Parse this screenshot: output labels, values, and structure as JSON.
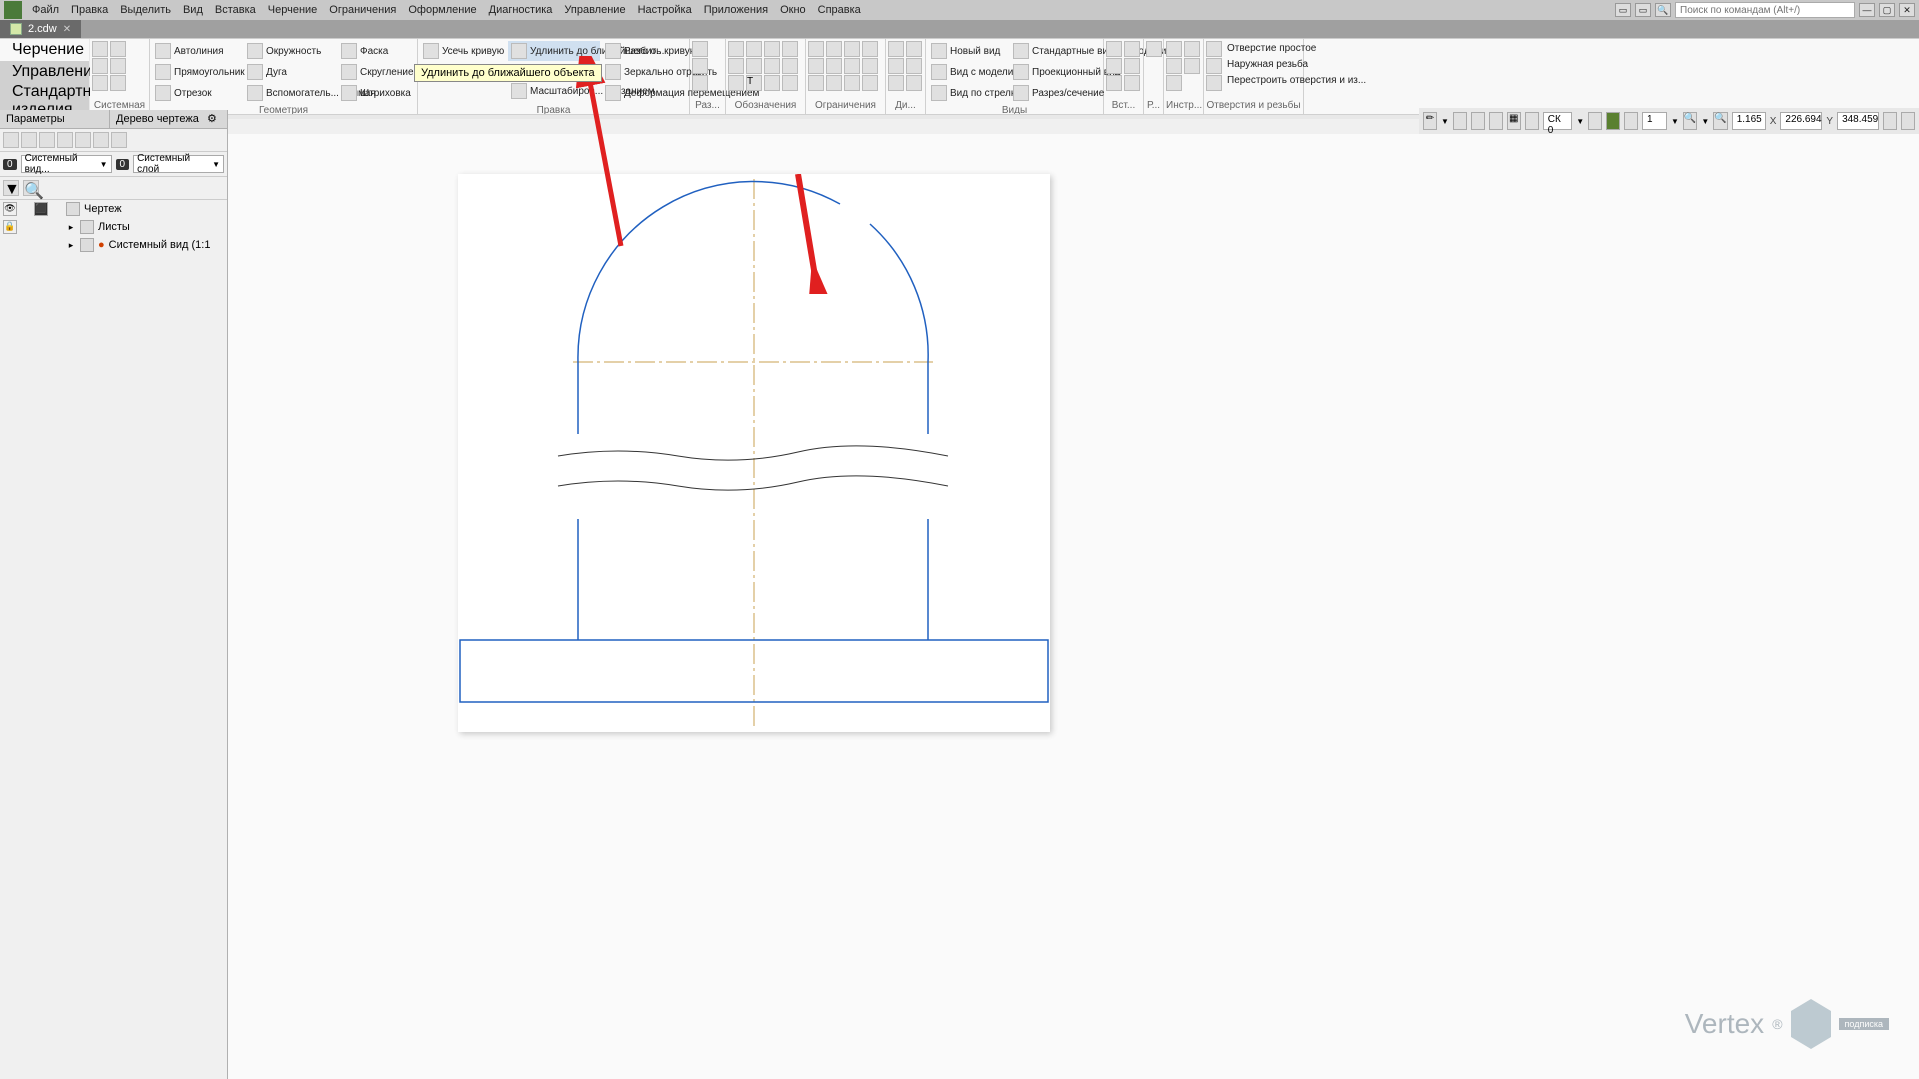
{
  "menu": [
    "Файл",
    "Правка",
    "Выделить",
    "Вид",
    "Вставка",
    "Черчение",
    "Ограничения",
    "Оформление",
    "Диагностика",
    "Управление",
    "Настройка",
    "Приложения",
    "Окно",
    "Справка"
  ],
  "search_placeholder": "Поиск по командам (Alt+/)",
  "doc_tab": "2.cdw",
  "ribbon_tabs": {
    "active": "Черчение",
    "other": "Управление",
    "third": "Стандартные изделия"
  },
  "tooltip": "Удлинить до ближайшего объекта",
  "ribbon_groups": {
    "system": "Системная",
    "geometry": "Геометрия",
    "edit": "Правка",
    "r1": "Раз...",
    "notes": "Обозначения",
    "constr": "Ограничения",
    "diag": "Ди...",
    "views": "Виды",
    "insert": "Вст...",
    "reports": "Р...",
    "tools": "Инстр...",
    "holes": "Отверстия и резьбы"
  },
  "cmd": {
    "autoline": "Автолиния",
    "rect": "Прямоугольник",
    "segment": "Отрезок",
    "circle": "Окружность",
    "arc": "Дуга",
    "aux": "Вспомогатель... прямая",
    "chamfer": "Фаска",
    "fillet": "Скругление",
    "hatch": "Штриховка",
    "trim": "Усечь кривую",
    "extend": "Удлинить до ближайшего о...",
    "scale": "Масштабиров... указанием",
    "break": "Разбить кривую",
    "mirror": "Зеркально отразить",
    "deform": "Деформация перемещением",
    "newview": "Новый вид",
    "modelview": "Вид с модели...",
    "arrowview": "Вид по стрелке",
    "stdviews": "Стандартные виды с модели...",
    "projview": "Проекционный вид",
    "section": "Разрез/сечение",
    "hole": "Отверстие простое",
    "thread": "Наружная резьба",
    "rebuild": "Перестроить отверстия и из..."
  },
  "panel": {
    "params": "Параметры",
    "tree": "Дерево чертежа",
    "view": "Системный вид...",
    "layer": "Системный слой",
    "root": "Чертеж",
    "sheets": "Листы",
    "sysview": "Системный вид (1:1"
  },
  "status": {
    "cs": "СК 0",
    "scale": "1",
    "zoom": "1.165",
    "x": "226.694",
    "y": "348.459",
    "xl": "X",
    "yl": "Y"
  },
  "wm": {
    "text": "Vertex",
    "sub": "подписка"
  }
}
